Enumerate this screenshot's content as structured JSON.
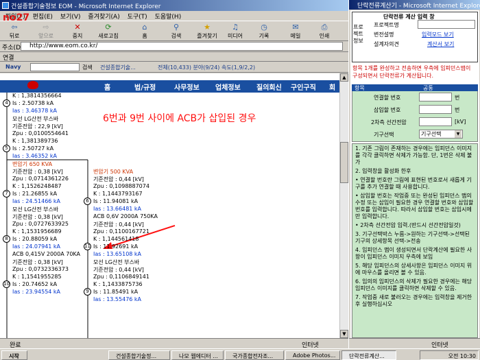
{
  "ie": {
    "title": "건설종합기술정보 EOM - Microsoft Internet Explorer",
    "menus": [
      "파일(F)",
      "편집(E)",
      "보기(V)",
      "즐겨찾기(A)",
      "도구(T)",
      "도움말(H)"
    ],
    "toolbar": [
      {
        "label": "뒤로",
        "icon": "back-icon"
      },
      {
        "label": "앞으로",
        "icon": "forward-icon"
      },
      {
        "label": "중지",
        "icon": "stop-icon"
      },
      {
        "label": "새로고침",
        "icon": "refresh-icon"
      },
      {
        "label": "홈",
        "icon": "home-icon"
      },
      {
        "label": "검색",
        "icon": "search-icon"
      },
      {
        "label": "즐겨찾기",
        "icon": "favorites-icon"
      },
      {
        "label": "미디어",
        "icon": "media-icon"
      },
      {
        "label": "기록",
        "icon": "history-icon"
      },
      {
        "label": "메일",
        "icon": "mail-icon"
      },
      {
        "label": "인쇄",
        "icon": "print-icon"
      }
    ],
    "address_label": "주소(D)",
    "address_value": "http://www.eom.co.kr/",
    "links_label": "연결",
    "navy_label": "Navy",
    "navy_search": "검색",
    "navy_text": "건설종합기술...",
    "navy_stats": "전체(10,433) 분야(9/24) 속도(1,9/2,2)",
    "status": "완료",
    "zone": "인터넷"
  },
  "overlay_label": "no27",
  "site_nav": [
    "홈",
    "법/규정",
    "사무정보",
    "업체정보",
    "질의회신",
    "구인구직",
    "회"
  ],
  "diagram": {
    "annotation": "6번과  9번 사이에 ACB가 삽입된 경우",
    "left": [
      {
        "k": "K : 1,3814356664"
      },
      {
        "node": "4",
        "is": "Is : 2.50738 kA"
      },
      {
        "ias": "Ias : 3.46378 kA"
      },
      {
        "t": "모선 LG산전 부스바"
      },
      {
        "t": "기준전압 : 22,9 [kV]"
      },
      {
        "t": "Zpu : 0,0100554641"
      },
      {
        "t": "K : 1,381389736"
      },
      {
        "node": "5",
        "is": "Is : 2.50727 kA"
      },
      {
        "ias": "Ias : 3.46352 kA"
      },
      {
        "red": "변압기 650 KVA"
      },
      {
        "t": "기준전압 : 0,38 [kV]"
      },
      {
        "t": "Zpu : 0,0714361226"
      },
      {
        "t": "K : 1,1526248487"
      },
      {
        "node": "7",
        "is": "Is : 21.26855 kA"
      },
      {
        "ias": "Ias : 24.51466 kA"
      },
      {
        "t": "모선 LG산전 부스바"
      },
      {
        "t": "기준전압 : 0,38 [kV]"
      },
      {
        "t": "Zpu : 0,0727633925"
      },
      {
        "t": "K : 1,1531956689"
      },
      {
        "node": "8",
        "is": "Is : 20.88059 kA"
      },
      {
        "ias": "Ias : 24.07941 kA"
      },
      {
        "t": "ACB 0,415V 2000A 70KA"
      },
      {
        "t": "기준전압 : 0,38 [kV]"
      },
      {
        "t": "Zpu : 0,0732336373"
      },
      {
        "t": "K : 1,1541955285"
      },
      {
        "node": "10",
        "is": "Is : 20.74652 kA"
      },
      {
        "ias": "Ias : 23.94554 kA"
      }
    ],
    "right": [
      {
        "red": "변압기 500 KVA"
      },
      {
        "t": "기준전압 : 0,44 [kV]"
      },
      {
        "t": "Zpu : 0,1098887074"
      },
      {
        "t": "K : 1,1443793167"
      },
      {
        "node": "6",
        "is": "Is : 11.94081 kA"
      },
      {
        "ias": "Ias : 13.66481 kA"
      },
      {
        "t": "ACB 0,6V 2000A 750KA"
      },
      {
        "t": "기준전압 : 0,44 [kV]"
      },
      {
        "t": "Zpu : 0,1100167721"
      },
      {
        "t": "K : 1,144561418"
      },
      {
        "node": "11",
        "is": "Is : 11.92691 kA"
      },
      {
        "ias": "Ias : 13.65108 kA"
      },
      {
        "t": "모선 LG산전 부스바"
      },
      {
        "t": "기준전압 : 0,44 [kV]"
      },
      {
        "t": "Zpu : 0,1106849141"
      },
      {
        "t": "K : 1,1433875736"
      },
      {
        "node": "9",
        "is": "Is : 11.85491 kA"
      },
      {
        "ias": "Ias : 13.55476 kA"
      }
    ]
  },
  "popup": {
    "title": "단락전류계산기 - Microsoft Internet Explorer",
    "header": "단락전류 계산 입력 창",
    "proj_label": "프로젝트정보",
    "rows": [
      {
        "label": "프로젝트명",
        "value": ""
      },
      {
        "label": "변전설명",
        "value": "입력모드 보기"
      },
      {
        "label": "설계자의견",
        "value": "계산서 보기"
      }
    ],
    "notice": "항목 1개를 완성하고 전송하면 우측에 임피던스맵이 구성되면서 단락전류가 계산됩니다.",
    "item_label": "항목",
    "common_label": "공통",
    "fields": [
      {
        "label": "연결할 번호",
        "unit": "번"
      },
      {
        "label": "삽입할 번호",
        "unit": "번"
      },
      {
        "label": "2차측 선간전압",
        "unit": "[kV]"
      },
      {
        "label": "기구선택",
        "select": "기구선택"
      }
    ],
    "instructions": [
      "1. 기존 그림이 존재하는 경우에는 임피던스 이미지를 각각 클릭하면 삭제가 가능함. 단, 1번은 삭제 불가",
      "2. 입력창을 활성화 한후",
      "• 연결할 번호란 그림에 표현된 번호로서 새롭게 기구를 추가 연결할 때 사용합니다.",
      "• 삽입할 번호는 작업중 또는 완성된 임피던스 맵의 수정 또는 삽입이 필요한 경우 연결할 번호와 삽입할 번호를 입력합니다. 따라서 삽입할 번호는 삽입시에만 입력합니다.",
      "• 2차측 선간전압 입력.(반드시 선간전압일것)",
      "3. 기구선택박스 누름->원하는 기구선택->선택된 기구의 상세항목 선택->전송",
      "4. 임피던스 맵이 생성되면서 단락계산에 필요한 사항이 임피던스 이미지 우측에 보임",
      "5. 해당 임피던스의 상세사항은 임피던스 이미지 위에 마우스를 올리면 볼 수 있음.",
      "6. 임의의 임피던스의 삭제가 필요한 경우에는 해당 임피던스 이미지를 클릭하면 삭제할 수 있음.",
      "7. 작업중 새로 불러오는 경우에는 입력창을 제거한 후 실행하십시오"
    ],
    "zone": "인터넷"
  },
  "taskbar": {
    "start": "시작",
    "tasks": [
      "건설종합기술정...",
      "나모 웹에디터 ...",
      "국가종합전자조...",
      "Adobe Photos...",
      "단락전류계산..."
    ],
    "clock": "오전 10:30"
  },
  "colors": {
    "accent": "#0a246a",
    "red": "#ff1010",
    "blue": "#0033cc",
    "green_panel": "#c8e8c8",
    "nav": "#1a4fa0"
  }
}
